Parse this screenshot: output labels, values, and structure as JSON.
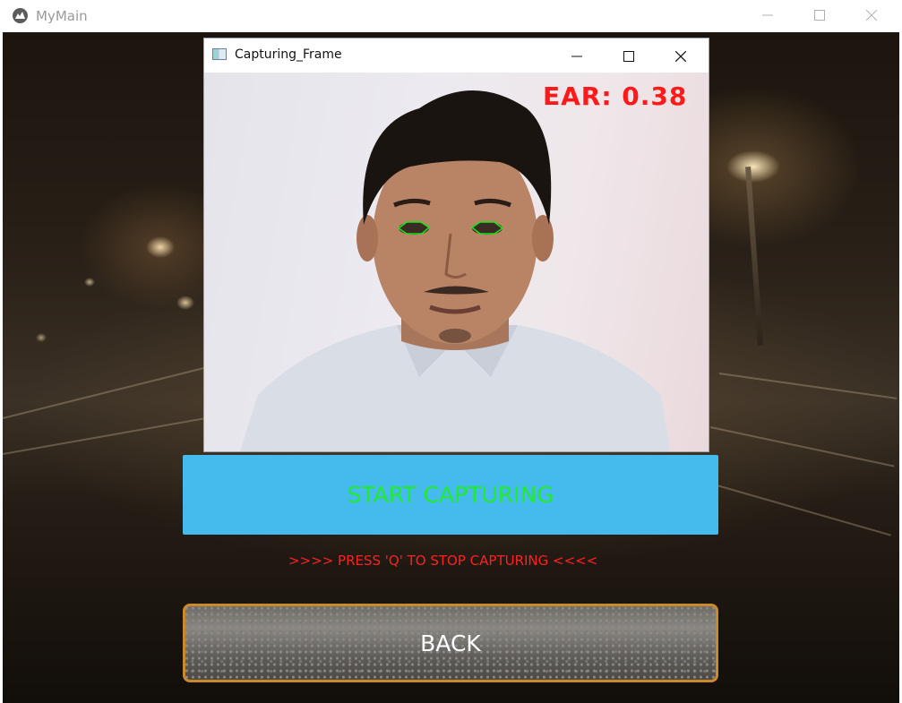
{
  "window": {
    "title": "MyMain",
    "icon": "kivy-logo-icon",
    "controls": [
      "minimize-icon",
      "maximize-icon",
      "close-icon"
    ]
  },
  "capture_window": {
    "title": "Capturing_Frame",
    "icon": "window-app-icon",
    "controls": [
      "minimize-icon",
      "maximize-icon",
      "close-icon"
    ],
    "ear_readout": "EAR: 0.38"
  },
  "start_button": {
    "label": "START CAPTURING",
    "background": "#44bbec",
    "text_color": "#22ea2e"
  },
  "hint": {
    "text": ">>>> PRESS 'Q' TO STOP CAPTURING <<<<",
    "color": "#ff2020"
  },
  "back_button": {
    "label": "BACK",
    "border_color": "#c98a2e"
  },
  "colors": {
    "eye_outline": "#19e619",
    "ear_text": "#ff1a1a"
  }
}
